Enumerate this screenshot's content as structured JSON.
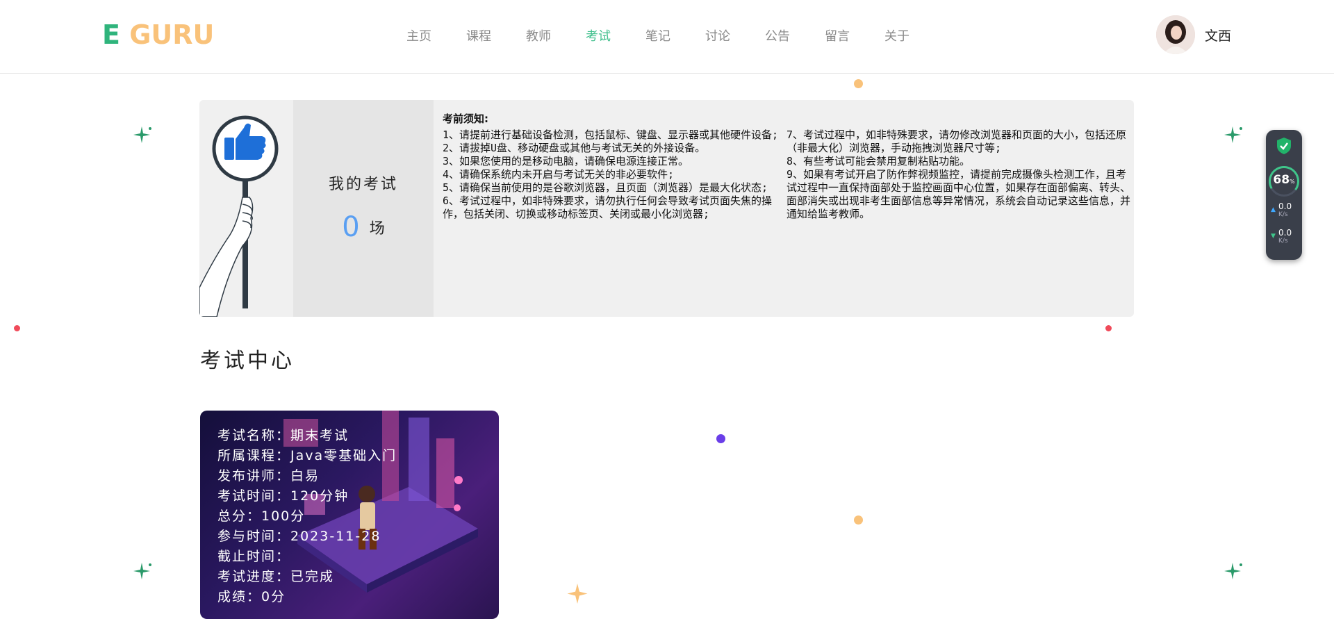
{
  "header": {
    "logo_e": "E",
    "logo_guru": "GURU",
    "nav": [
      {
        "label": "主页",
        "active": false
      },
      {
        "label": "课程",
        "active": false
      },
      {
        "label": "教师",
        "active": false
      },
      {
        "label": "考试",
        "active": true
      },
      {
        "label": "笔记",
        "active": false
      },
      {
        "label": "讨论",
        "active": false
      },
      {
        "label": "公告",
        "active": false
      },
      {
        "label": "留言",
        "active": false
      },
      {
        "label": "关于",
        "active": false
      }
    ],
    "user_name": "文西"
  },
  "my_exams": {
    "label": "我的考试",
    "count": "0",
    "unit": "场"
  },
  "notice": {
    "title": "考前须知:",
    "left": [
      "1、请提前进行基础设备检测，包括鼠标、键盘、显示器或其他硬件设备;",
      "2、请拔掉U盘、移动硬盘或其他与考试无关的外接设备。",
      "3、如果您使用的是移动电脑，请确保电源连接正常。",
      "4、请确保系统内未开启与考试无关的非必要软件;",
      "5、请确保当前使用的是谷歌浏览器，且页面（浏览器）是最大化状态;",
      "6、考试过程中，如非特殊要求，请勿执行任何会导致考试页面失焦的操作，包括关闭、切换或移动标签页、关闭或最小化浏览器;"
    ],
    "right": [
      "7、考试过程中，如非特殊要求，请勿修改浏览器和页面的大小，包括还原（非最大化）浏览器，手动拖拽浏览器尺寸等;",
      "8、有些考试可能会禁用复制粘贴功能。",
      "9、如果有考试开启了防作弊视频监控，请提前完成摄像头检测工作，且考试过程中一直保持面部处于监控画面中心位置，如果存在面部偏离、转头、面部消失或出现非考生面部信息等异常情况，系统会自动记录这些信息，并通知给监考教师。"
    ]
  },
  "section_title": "考试中心",
  "exam_card": {
    "name": "考试名称：期末考试",
    "course": "所属课程：Java零基础入门",
    "teacher": "发布讲师：白易",
    "duration": "考试时间：120分钟",
    "total": "总分：100分",
    "join_time": "参与时间：2023-11-28",
    "deadline": "截止时间：",
    "progress": "考试进度：已完成",
    "score": "成绩：0分"
  },
  "speed_widget": {
    "percent": "68",
    "percent_unit": "%",
    "up": "0.0",
    "up_unit": "K/s",
    "down": "0.0",
    "down_unit": "K/s"
  },
  "colors": {
    "accent": "#3fbf8c",
    "logo_e": "#2fb47c",
    "logo_guru": "#f9c27a",
    "count": "#5a9ff2"
  }
}
